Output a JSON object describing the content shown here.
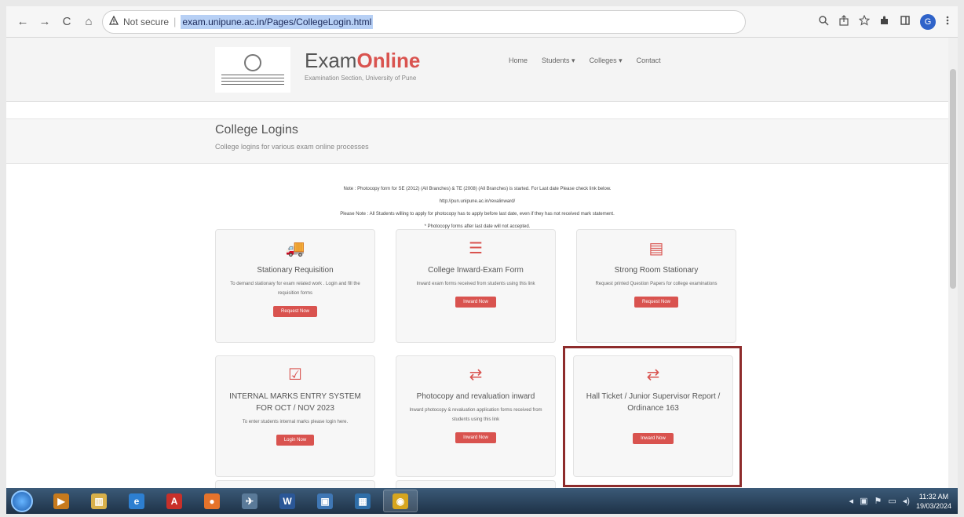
{
  "browser": {
    "nav": {
      "back": "←",
      "forward": "→",
      "reload": "C",
      "home": "⌂"
    },
    "security_icon": "warning-icon",
    "security_label": "Not secure",
    "url": "exam.unipune.ac.in/Pages/CollegeLogin.html",
    "toolbar_icons": [
      "zoom-icon",
      "share-icon",
      "star-icon",
      "extensions-icon",
      "sidepanel-icon"
    ],
    "avatar_letter": "G"
  },
  "site": {
    "brand_prefix": "Exam",
    "brand_suffix": "Online",
    "brand_sub": "Examination Section, University of Pune",
    "nav": [
      "Home",
      "Students ▾",
      "Colleges ▾",
      "Contact"
    ]
  },
  "banner": {
    "title": "College Logins",
    "subtitle": "College logins for various exam online processes"
  },
  "notes": {
    "line1": "Note : Photocopy form for SE (2012) (All Branches) & TE (2008) (All Branches) is started. For Last date Please check link below.",
    "line2": "http://pun.unipune.ac.in/revalinward/",
    "line3": "Please Note : All Students willing to apply for photocopy has to apply before last date, even if they has not received mark statement.",
    "line4": "* Photocopy forms after last date will not accepted."
  },
  "cards": [
    {
      "icon": "truck-icon",
      "glyph": "🚚",
      "title": "Stationary Requisition",
      "desc": "To demand stationary for exam related work . Login and fill the requisition forms",
      "button": "Request Now"
    },
    {
      "icon": "list-icon",
      "glyph": "☰",
      "title": "College Inward-Exam Form",
      "desc": "Inward exam forms received from students using this link",
      "button": "Inward Now"
    },
    {
      "icon": "archive-icon",
      "glyph": "▤",
      "title": "Strong Room Stationary",
      "desc": "Request printed Question Papers for college examinations",
      "button": "Request Now"
    },
    {
      "icon": "checkbox-icon",
      "glyph": "☑",
      "title": "INTERNAL MARKS ENTRY SYSTEM FOR OCT / NOV 2023",
      "desc": "To enter students internal marks please login here.",
      "button": "Login Now"
    },
    {
      "icon": "retweet-icon",
      "glyph": "⇄",
      "title": "Photocopy and revaluation inward",
      "desc": "Inward photocopy & revaluation application forms received from students using this link",
      "button": "Inward Now"
    },
    {
      "icon": "retweet-icon",
      "glyph": "⇄",
      "title": "Hall Ticket / Junior Supervisor Report / Ordinance 163",
      "desc": "",
      "button": "Inward Now"
    }
  ],
  "taskbar": {
    "apps": [
      {
        "name": "media-player-icon",
        "glyph": "▶",
        "color": "#c77a1d"
      },
      {
        "name": "file-explorer-icon",
        "glyph": "▥",
        "color": "#d8b04a"
      },
      {
        "name": "internet-explorer-icon",
        "glyph": "e",
        "color": "#2d7fd1"
      },
      {
        "name": "acrobat-icon",
        "glyph": "A",
        "color": "#c8302a"
      },
      {
        "name": "firefox-icon",
        "glyph": "●",
        "color": "#e5732b"
      },
      {
        "name": "satellite-app-icon",
        "glyph": "✈",
        "color": "#5a7a99"
      },
      {
        "name": "word-icon",
        "glyph": "W",
        "color": "#2b5797"
      },
      {
        "name": "window-app-icon",
        "glyph": "▣",
        "color": "#3f77b5"
      },
      {
        "name": "remote-desktop-icon",
        "glyph": "▦",
        "color": "#2f6ea8"
      },
      {
        "name": "chrome-icon",
        "glyph": "◉",
        "color": "#d6a51f"
      }
    ],
    "tray_icons": [
      "chevron-left-icon",
      "tray-app-icon",
      "flag-icon",
      "network-icon",
      "volume-icon"
    ],
    "time": "11:32 AM",
    "date": "19/03/2024"
  }
}
